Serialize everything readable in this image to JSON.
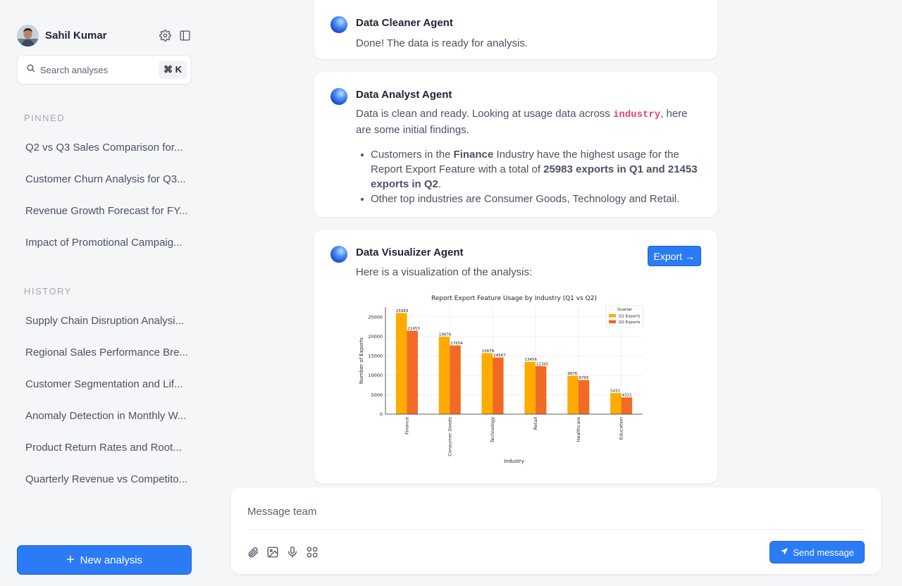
{
  "user": {
    "name": "Sahil Kumar"
  },
  "search": {
    "placeholder": "Search analyses",
    "shortcut": "⌘ K"
  },
  "sidebar": {
    "pinned_label": "PINNED",
    "pinned": [
      "Q2 vs Q3 Sales Comparison for...",
      "Customer Churn Analysis for Q3...",
      "Revenue Growth Forecast for FY...",
      "Impact of Promotional Campaig..."
    ],
    "history_label": "HISTORY",
    "history": [
      "Supply Chain Disruption Analysi...",
      "Regional Sales Performance Bre...",
      "Customer Segmentation and Lif...",
      "Anomaly Detection in Monthly W...",
      "Product Return Rates and Root...",
      "Quarterly Revenue vs Competito..."
    ],
    "new_analysis": "New analysis"
  },
  "messages": {
    "cleaner": {
      "agent": "Data Cleaner Agent",
      "text": "Done! The data is ready for analysis."
    },
    "analyst": {
      "agent": "Data Analyst Agent",
      "intro_before": "Data is clean and ready. Looking at usage data across ",
      "intro_code": "industry",
      "intro_after": ", here are some initial findings.",
      "b1_a": "Customers in the ",
      "b1_b": "Finance",
      "b1_c": " Industry have the highest usage for the Report Export Feature with a total of ",
      "b1_d": "25983 exports in Q1 and 21453 exports in Q2",
      "b1_e": ".",
      "b2": "Other top industries are Consumer Goods, Technology and Retail."
    },
    "visualizer": {
      "agent": "Data Visualizer Agent",
      "text": "Here is a visualization of the analysis:",
      "export": "Export"
    }
  },
  "composer": {
    "placeholder": "Message team",
    "send": "Send message"
  },
  "colors": {
    "accent": "#2b7bf6",
    "q1": "#ffab00",
    "q2": "#f26b24"
  },
  "chart_data": {
    "type": "bar",
    "title": "Report Export Feature Usage by Industry (Q1 vs Q2)",
    "xlabel": "Industry",
    "ylabel": "Number of Exports",
    "legend_title": "Quarter",
    "legend_position": "top-right",
    "categories": [
      "Finance",
      "Consumer Goods",
      "Technology",
      "Retail",
      "Healthcare",
      "Education"
    ],
    "series": [
      {
        "name": "Q1 Exports",
        "values": [
          25983,
          19876,
          15678,
          13456,
          9876,
          5432
        ]
      },
      {
        "name": "Q2 Exports",
        "values": [
          21453,
          17654,
          14567,
          12345,
          8765,
          4321
        ]
      }
    ],
    "yticks": [
      0,
      5000,
      10000,
      15000,
      20000,
      25000
    ],
    "ylim": [
      0,
      27500
    ],
    "grid": true
  }
}
